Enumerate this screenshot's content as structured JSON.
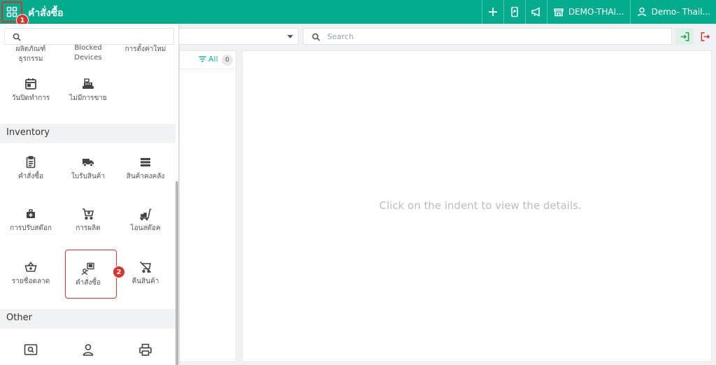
{
  "header": {
    "title": "คำสั่งซื้อ",
    "store_label": "DEMO-THAI...",
    "user_label": "Demo- Thail...",
    "accent_color": "#00ab8e"
  },
  "annotations": {
    "step1": "1",
    "step2": "2"
  },
  "toolbar": {
    "search_placeholder": "Search"
  },
  "list": {
    "filter_label": "All",
    "count": "0"
  },
  "detail": {
    "empty_message": "Click on the indent to view the details."
  },
  "drawer": {
    "partial_row": [
      {
        "label1": "ผลิตภัณฑ์",
        "label2": "ธุรกรรม",
        "icon": "report-icon"
      },
      {
        "label1": "Blocked",
        "label2": "Devices",
        "icon": "blocked-devices-icon"
      },
      {
        "label1": "การตั้งค่าใหม่",
        "label2": "",
        "icon": "settings-icon"
      }
    ],
    "row_top": [
      {
        "label": "วันปิดทำการ",
        "icon": "calendar-icon"
      },
      {
        "label": "ไม่มีการขาย",
        "icon": "cash-register-icon"
      }
    ],
    "sections": {
      "inventory": "Inventory",
      "other": "Other"
    },
    "inventory_items": [
      {
        "label": "คำสั่งซื้อ",
        "icon": "clipboard-icon"
      },
      {
        "label": "ใบรับสินค้า",
        "icon": "truck-icon"
      },
      {
        "label": "สินค้าคงคลัง",
        "icon": "stock-list-icon"
      },
      {
        "label": "การปรับสต๊อก",
        "icon": "adjust-kit-icon"
      },
      {
        "label": "การผลิต",
        "icon": "cart-add-icon"
      },
      {
        "label": "โอนสต๊อค",
        "icon": "transfer-icon"
      },
      {
        "label": "รายชื่อตลาด",
        "icon": "basket-icon"
      },
      {
        "label": "คำสั่งซื้อ",
        "icon": "indent-icon"
      },
      {
        "label": "คืนสินค้า",
        "icon": "cart-off-icon"
      }
    ],
    "other_items": [
      {
        "icon": "search-screen-icon"
      },
      {
        "icon": "user-icon"
      },
      {
        "icon": "printer-icon"
      }
    ]
  }
}
